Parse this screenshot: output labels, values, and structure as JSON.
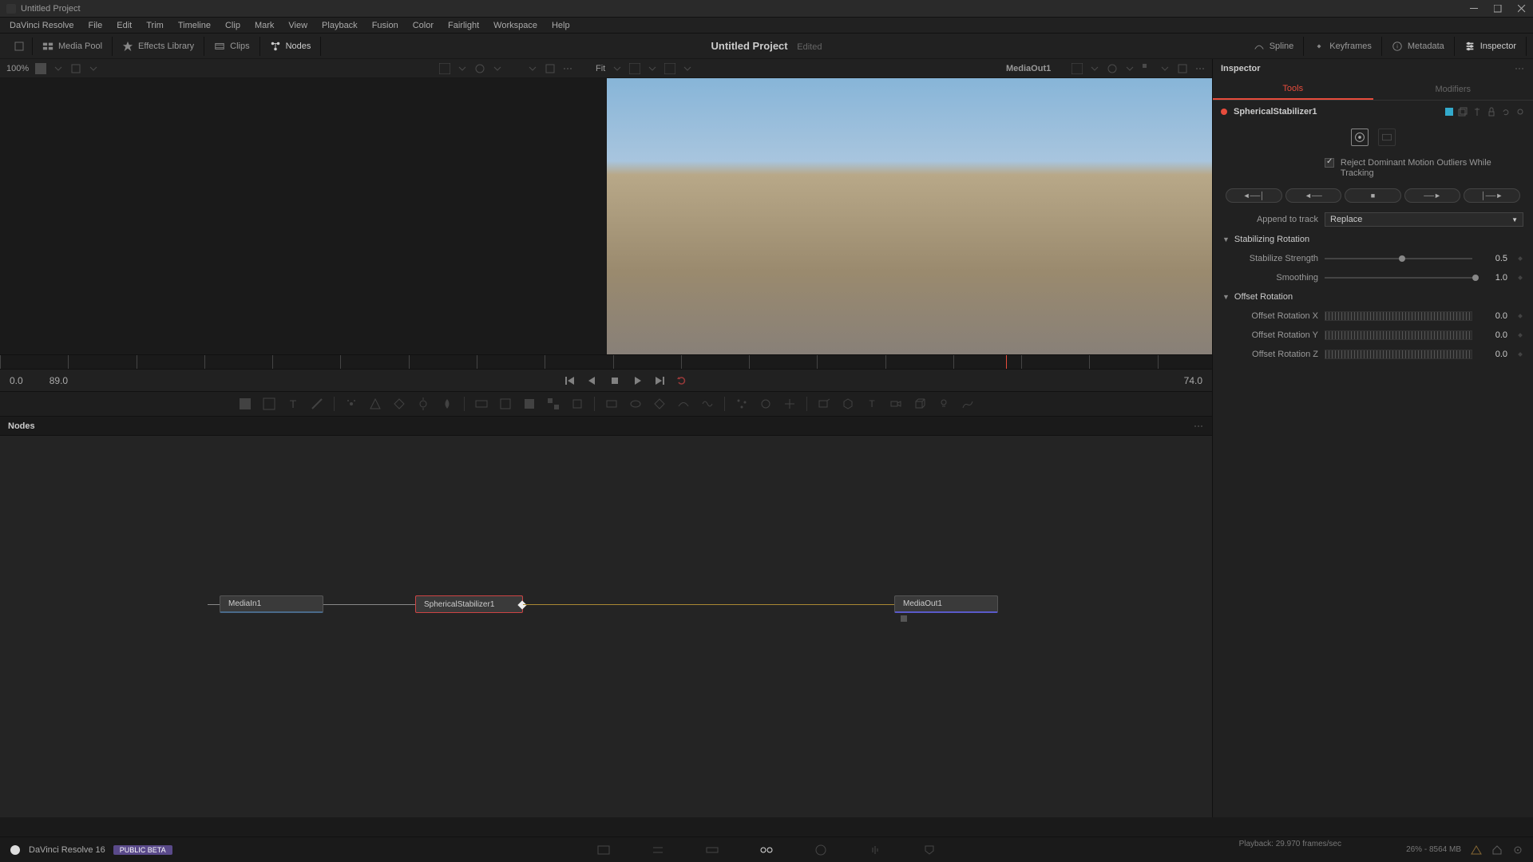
{
  "titlebar": {
    "title": "Untitled Project"
  },
  "menubar": [
    "DaVinci Resolve",
    "File",
    "Edit",
    "Trim",
    "Timeline",
    "Clip",
    "Mark",
    "View",
    "Playback",
    "Fusion",
    "Color",
    "Fairlight",
    "Workspace",
    "Help"
  ],
  "toolbar": {
    "left": [
      {
        "name": "media-pool",
        "label": "Media Pool",
        "icon": "media-pool-icon"
      },
      {
        "name": "effects-library",
        "label": "Effects Library",
        "icon": "effects-icon"
      },
      {
        "name": "clips",
        "label": "Clips",
        "icon": "clips-icon"
      },
      {
        "name": "nodes",
        "label": "Nodes",
        "icon": "nodes-icon",
        "active": true
      }
    ],
    "right": [
      {
        "name": "spline",
        "label": "Spline",
        "icon": "spline-icon"
      },
      {
        "name": "keyframes",
        "label": "Keyframes",
        "icon": "keyframes-icon"
      },
      {
        "name": "metadata",
        "label": "Metadata",
        "icon": "metadata-icon"
      },
      {
        "name": "inspector",
        "label": "Inspector",
        "icon": "inspector-icon",
        "active": true
      }
    ],
    "project_title": "Untitled Project",
    "project_status": "Edited"
  },
  "subtoolbar": {
    "zoom": "100%",
    "viewer_label": "MediaOut1",
    "fit_label": "Fit"
  },
  "transport": {
    "start": "0.0",
    "end": "89.0",
    "current": "74.0"
  },
  "nodes_panel": {
    "title": "Nodes",
    "nodes": {
      "mediain": "MediaIn1",
      "stabilizer": "SphericalStabilizer1",
      "mediaout": "MediaOut1"
    }
  },
  "inspector": {
    "title": "Inspector",
    "tabs": {
      "tools": "Tools",
      "modifiers": "Modifiers"
    },
    "node_name": "SphericalStabilizer1",
    "reject_motion": "Reject Dominant Motion Outliers While Tracking",
    "append_label": "Append to track",
    "append_value": "Replace",
    "sections": {
      "stabilizing_rotation": "Stabilizing Rotation",
      "offset_rotation": "Offset Rotation"
    },
    "params": {
      "stabilize_strength": {
        "label": "Stabilize Strength",
        "value": "0.5"
      },
      "smoothing": {
        "label": "Smoothing",
        "value": "1.0"
      },
      "offset_x": {
        "label": "Offset Rotation X",
        "value": "0.0"
      },
      "offset_y": {
        "label": "Offset Rotation Y",
        "value": "0.0"
      },
      "offset_z": {
        "label": "Offset Rotation Z",
        "value": "0.0"
      }
    }
  },
  "bottom": {
    "app_name": "DaVinci Resolve 16",
    "beta": "PUBLIC BETA",
    "playback": "Playback: 29.970 frames/sec",
    "memory": "26% - 8564 MB"
  }
}
